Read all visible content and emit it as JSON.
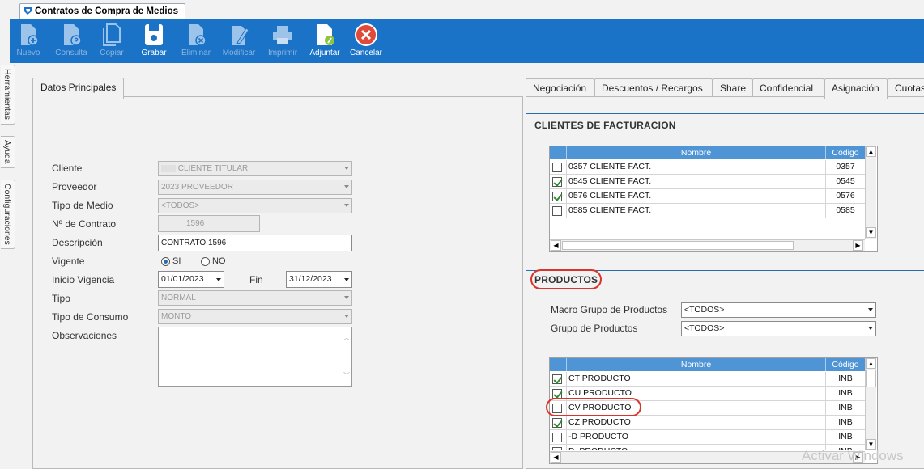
{
  "window": {
    "tab_title": "Contratos de Compra de Medios"
  },
  "toolbar": {
    "buttons": [
      {
        "label": "Nuevo",
        "icon": "new-doc-icon",
        "enabled": false
      },
      {
        "label": "Consulta",
        "icon": "query-doc-icon",
        "enabled": false
      },
      {
        "label": "Copiar",
        "icon": "copy-icon",
        "enabled": false
      },
      {
        "label": "Grabar",
        "icon": "save-icon",
        "enabled": true
      },
      {
        "label": "Eliminar",
        "icon": "delete-doc-icon",
        "enabled": false
      },
      {
        "label": "Modificar",
        "icon": "edit-icon",
        "enabled": false
      },
      {
        "label": "Imprimir",
        "icon": "printer-icon",
        "enabled": false
      },
      {
        "label": "Adjuntar",
        "icon": "attach-doc-icon",
        "enabled": true
      },
      {
        "label": "Cancelar",
        "icon": "cancel-icon",
        "enabled": true
      }
    ],
    "color": "#1a73c7"
  },
  "side_tabs": [
    "Herramientas",
    "Ayuda",
    "Configuraciones"
  ],
  "left_panel": {
    "tab": "Datos Principales",
    "fields": {
      "cliente": {
        "label": "Cliente",
        "value": "CLIENTE TITULAR"
      },
      "proveedor": {
        "label": "Proveedor",
        "value": "2023 PROVEEDOR"
      },
      "tipo_medio": {
        "label": "Tipo de Medio",
        "value": "<TODOS>"
      },
      "nro_contrato": {
        "label": "Nº de Contrato",
        "value": "1596"
      },
      "descripcion": {
        "label": "Descripción",
        "value": "CONTRATO 1596"
      },
      "vigente": {
        "label": "Vigente",
        "opt_si": "SI",
        "opt_no": "NO",
        "selected": "SI"
      },
      "inicio_vigencia": {
        "label": "Inicio Vigencia",
        "value": "01/01/2023"
      },
      "fin": {
        "label": "Fin",
        "value": "31/12/2023"
      },
      "tipo": {
        "label": "Tipo",
        "value": "NORMAL"
      },
      "tipo_consumo": {
        "label": "Tipo de Consumo",
        "value": "MONTO"
      },
      "observaciones": {
        "label": "Observaciones",
        "value": ""
      }
    }
  },
  "right_panel": {
    "tabs": [
      "Negociación",
      "Descuentos / Recargos",
      "Share",
      "Confidencial",
      "Asignación",
      "Cuotas"
    ],
    "active_tab": "Asignación",
    "clientes": {
      "title": "CLIENTES DE FACTURACION",
      "columns": [
        "Nombre",
        "Código"
      ],
      "rows": [
        {
          "checked": false,
          "nombre": "0357 CLIENTE FACT.",
          "codigo": "0357"
        },
        {
          "checked": true,
          "nombre": "0545 CLIENTE FACT.",
          "codigo": "0545"
        },
        {
          "checked": true,
          "nombre": "0576 CLIENTE FACT.",
          "codigo": "0576"
        },
        {
          "checked": false,
          "nombre": "0585 CLIENTE FACT.",
          "codigo": "0585"
        }
      ]
    },
    "productos": {
      "title": "PRODUCTOS",
      "macro_label": "Macro Grupo de Productos",
      "macro_value": "<TODOS>",
      "grupo_label": "Grupo de Productos",
      "grupo_value": "<TODOS>",
      "columns": [
        "Nombre",
        "Código"
      ],
      "rows": [
        {
          "checked": true,
          "nombre": "CT PRODUCTO",
          "codigo": "INB"
        },
        {
          "checked": true,
          "nombre": "CU PRODUCTO",
          "codigo": "INB"
        },
        {
          "checked": false,
          "nombre": "CV PRODUCTO",
          "codigo": "INB"
        },
        {
          "checked": true,
          "nombre": "CZ PRODUCTO",
          "codigo": "INB"
        },
        {
          "checked": false,
          "nombre": "-D PRODUCTO",
          "codigo": "INB"
        },
        {
          "checked": false,
          "nombre": "D_PRODUCTO",
          "codigo": "INB"
        }
      ]
    }
  },
  "watermark": "Activar Windows"
}
